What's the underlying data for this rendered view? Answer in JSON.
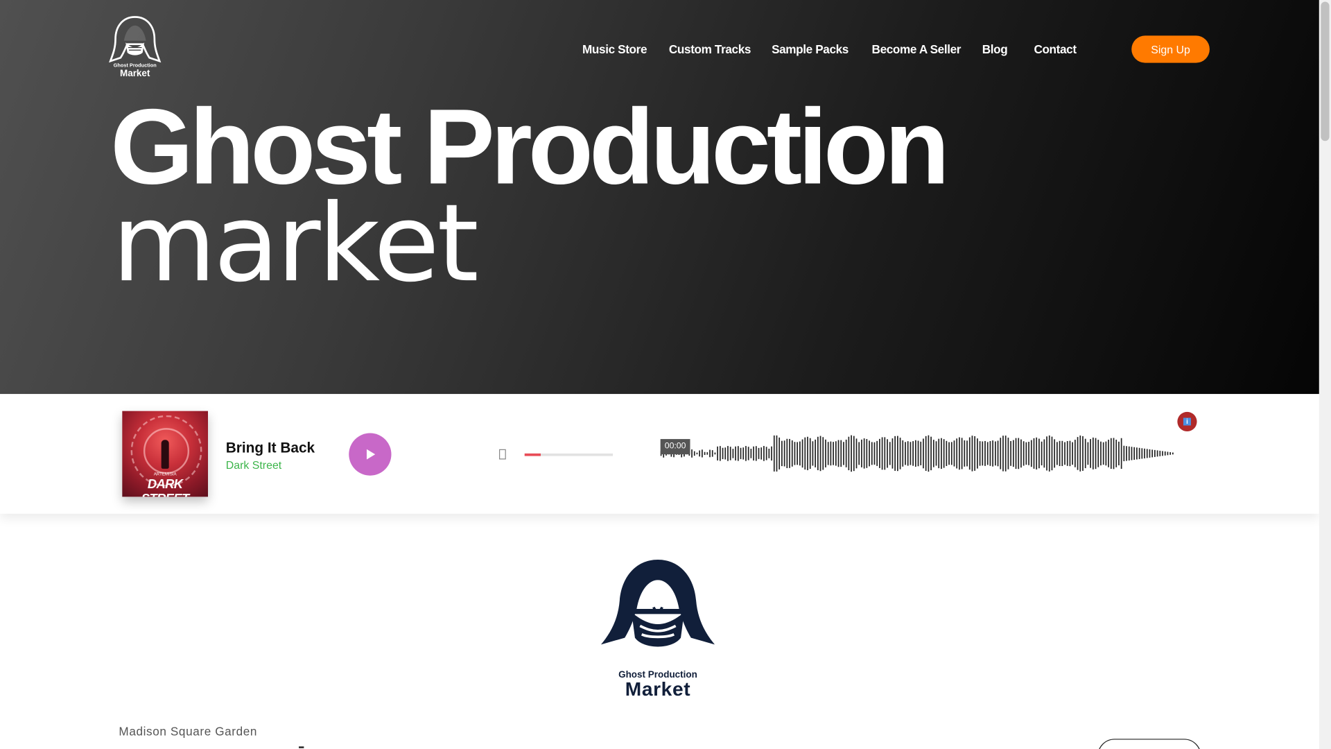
{
  "brand": {
    "line1": "Ghost Production",
    "line2": "Market"
  },
  "nav": {
    "items": [
      {
        "label": "Music Store"
      },
      {
        "label": "Custom Tracks"
      },
      {
        "label": "Sample Packs"
      },
      {
        "label": "Become A Seller"
      },
      {
        "label": "Blog"
      },
      {
        "label": "Contact"
      }
    ],
    "signup_label": "Sign Up"
  },
  "hero": {
    "title": "Ghost Production",
    "subtitle": "market"
  },
  "player": {
    "cover_small": "ARTEMISIA",
    "cover_title": "DARK STREET",
    "track_title": "Bring It Back",
    "artist": "Dark Street",
    "time": "00:00",
    "volume_fraction": 0.18,
    "play_color": "#c868c8",
    "accent_color": "#e84c57",
    "artist_color": "#3cb54a"
  },
  "content": {
    "venue": "Madison Square Garden"
  },
  "colors": {
    "signup": "#ff7a00",
    "info_button": "#b02a2a"
  },
  "icons": {
    "play": "play-icon",
    "volume": "volume-icon",
    "info": "info-icon"
  }
}
